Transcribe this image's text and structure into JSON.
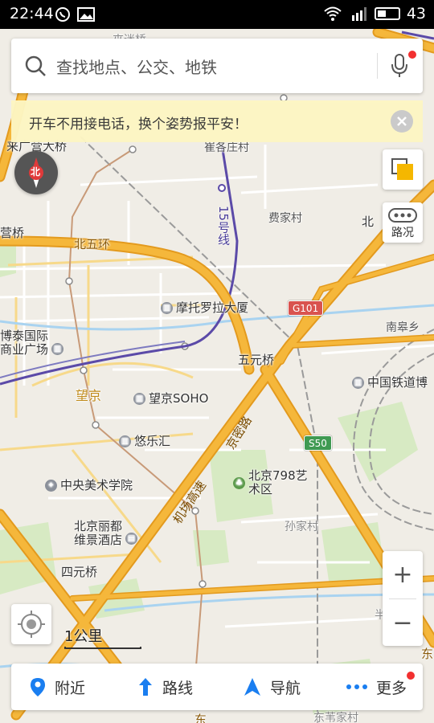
{
  "status_bar": {
    "time": "22:44",
    "battery": "43",
    "battery_level": 0.43
  },
  "search": {
    "placeholder": "查找地点、公交、地铁"
  },
  "banner": {
    "text": "开车不用接电话，换个姿势报平安！"
  },
  "compass": {
    "label": "北"
  },
  "traffic": {
    "label": "路况"
  },
  "scale": {
    "label": "1公里"
  },
  "zoom": {
    "in": "+",
    "out": "−"
  },
  "map": {
    "labels": {
      "laiguangying": "来广营大桥",
      "cuigezhuang": "崔各庄村",
      "feijia": "费家村",
      "bei_right": "北",
      "ying": "营桥",
      "beiwuhuan": "北五环",
      "motuoluola": "摩托罗拉大厦",
      "bosheng": "博泰国际\n商业广场",
      "nangao": "南皋乡",
      "wuyuanqiao": "五元桥",
      "zhongguotiedao": "中国铁道博",
      "wangjing": "望京",
      "wangjing_soho": "望京SOHO",
      "youlehui": "悠乐汇",
      "zhongyangmeishu": "中央美术学院",
      "beijing798": "北京798艺\n术区",
      "sunjia": "孙家村",
      "lidu": "北京丽都\n维景酒店",
      "siyuanqiao": "四元桥",
      "jingmilu": "京密路",
      "jichanggaosu": "机场高速",
      "metro15": "15号线",
      "g101": "G101",
      "s50": "S50",
      "ban": "半",
      "dong": "东",
      "bottom_right": "东",
      "top_cut": "來迷桥",
      "bottom_cut": "东苇家村"
    }
  },
  "bottom_bar": {
    "nearby": "附近",
    "route": "路线",
    "navigate": "导航",
    "more": "更多"
  },
  "colors": {
    "expressway": "#f5b73b",
    "expressway_edge": "#e39a1e",
    "metro15": "#5b4aa8",
    "rail": "#9a9a9a",
    "water": "#a9d3f0",
    "green": "#cfe6b8",
    "accent_blue": "#1a7ef0",
    "notify_red": "#f23030"
  }
}
